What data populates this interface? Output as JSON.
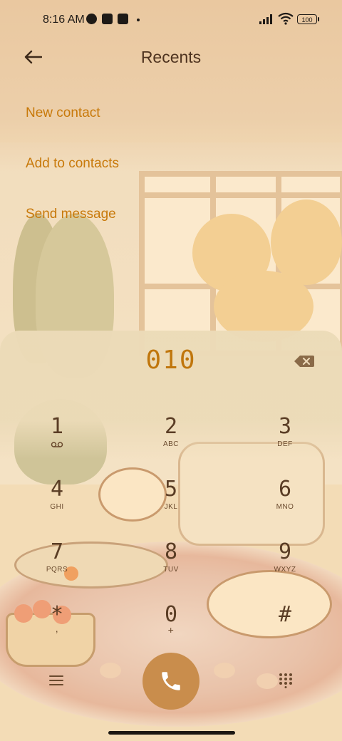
{
  "status_bar": {
    "time": "8:16 AM",
    "battery": "100",
    "icons": [
      "vpn-icon",
      "notification-square-icon",
      "upload-icon",
      "dot-icon",
      "signal-icon",
      "wifi-icon",
      "battery-icon"
    ]
  },
  "header": {
    "title": "Recents",
    "back_icon": "arrow-left-icon"
  },
  "options": {
    "new_contact": "New contact",
    "add_to_contacts": "Add to contacts",
    "send_message": "Send message"
  },
  "dialer": {
    "number": "010",
    "keys": [
      {
        "digit": "1",
        "letters": "",
        "icon": "voicemail-icon"
      },
      {
        "digit": "2",
        "letters": "ABC"
      },
      {
        "digit": "3",
        "letters": "DEF"
      },
      {
        "digit": "4",
        "letters": "GHI"
      },
      {
        "digit": "5",
        "letters": "JKL"
      },
      {
        "digit": "6",
        "letters": "MNO"
      },
      {
        "digit": "7",
        "letters": "PQRS"
      },
      {
        "digit": "8",
        "letters": "TUV"
      },
      {
        "digit": "9",
        "letters": "WXYZ"
      },
      {
        "digit": "*",
        "letters": ","
      },
      {
        "digit": "0",
        "letters": "+"
      },
      {
        "digit": "#",
        "letters": ""
      }
    ]
  },
  "colors": {
    "accent": "#c8790a",
    "title": "#4f3420",
    "call_button": "#c98d4c",
    "key_digit": "#5a3d25"
  }
}
